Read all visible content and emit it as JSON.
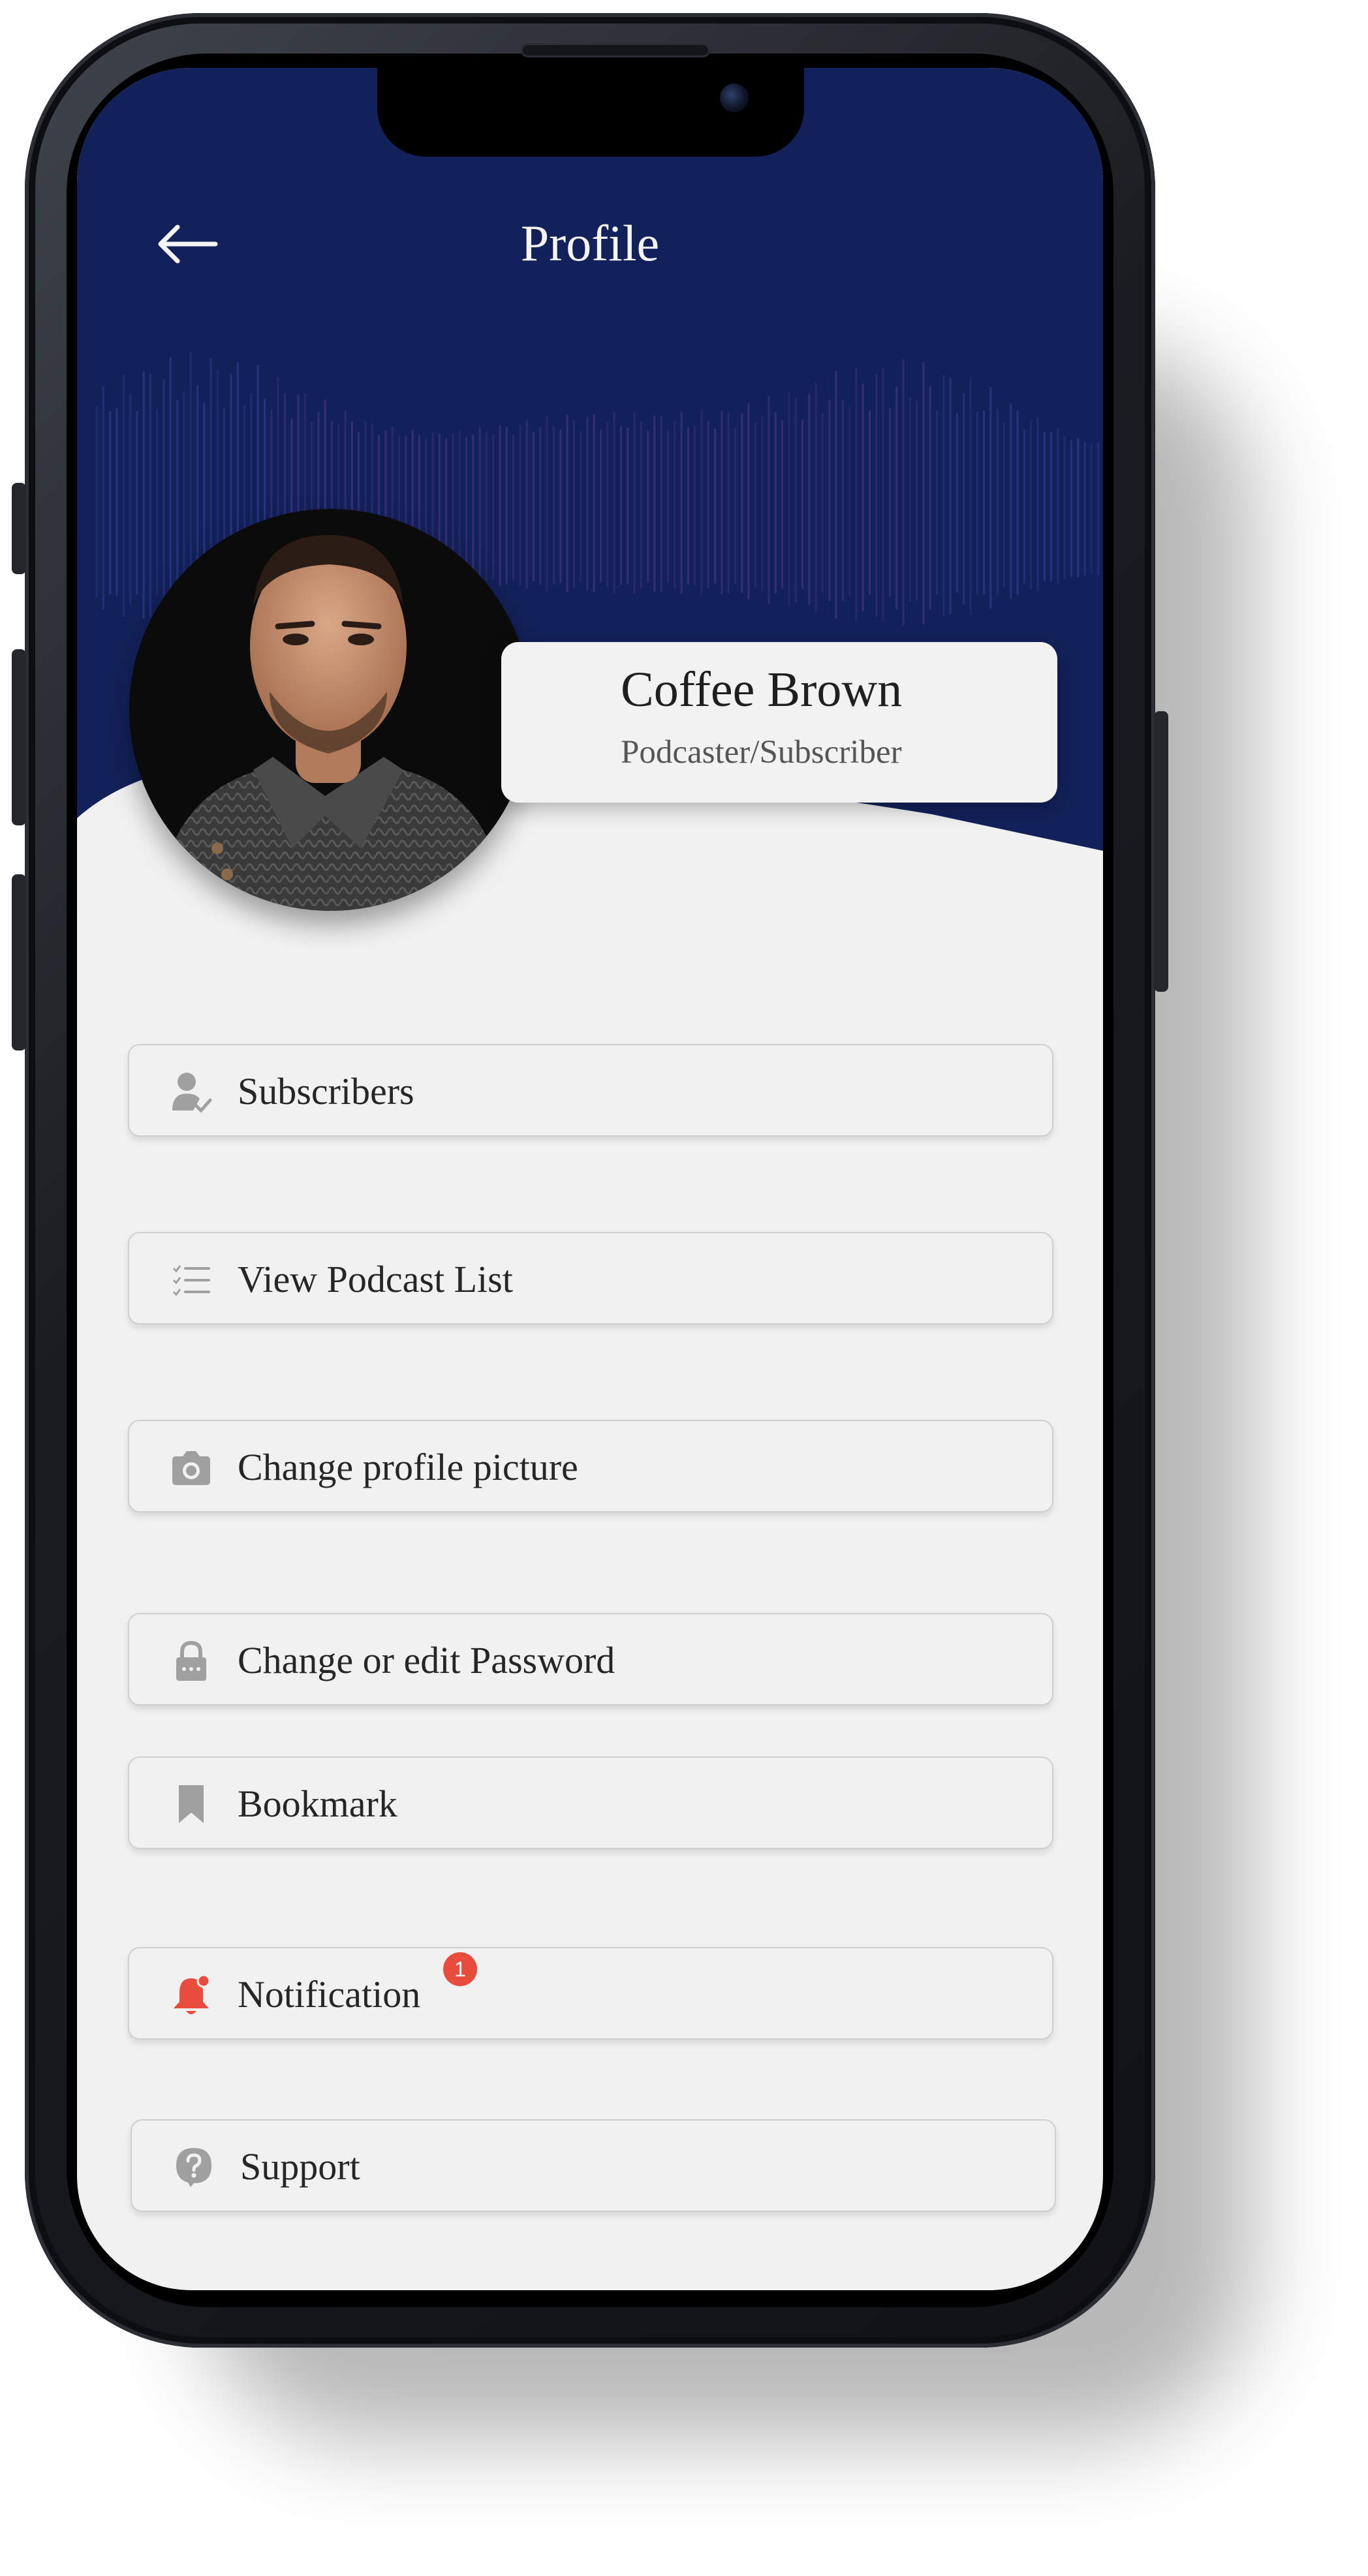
{
  "header": {
    "title": "Profile",
    "back_icon": "arrow-left-icon",
    "background_color": "#13215a"
  },
  "profile": {
    "name": "Coffee Brown",
    "role": "Podcaster/Subscriber"
  },
  "menu": [
    {
      "label": "Subscribers",
      "icon": "user-check-icon"
    },
    {
      "label": "View Podcast List",
      "icon": "list-icon"
    },
    {
      "label": "Change profile picture",
      "icon": "camera-icon"
    },
    {
      "label": "Change or edit Password",
      "icon": "lock-icon"
    },
    {
      "label": "Bookmark",
      "icon": "bookmark-icon"
    },
    {
      "label": "Notification",
      "icon": "bell-icon",
      "badge": "1",
      "icon_color": "#e74c3c"
    },
    {
      "label": "Support",
      "icon": "question-icon"
    }
  ],
  "colors": {
    "accent": "#13215a",
    "badge": "#e74c3c",
    "icon": "#a0a0a0",
    "screen_bg": "#f1f1f1"
  }
}
